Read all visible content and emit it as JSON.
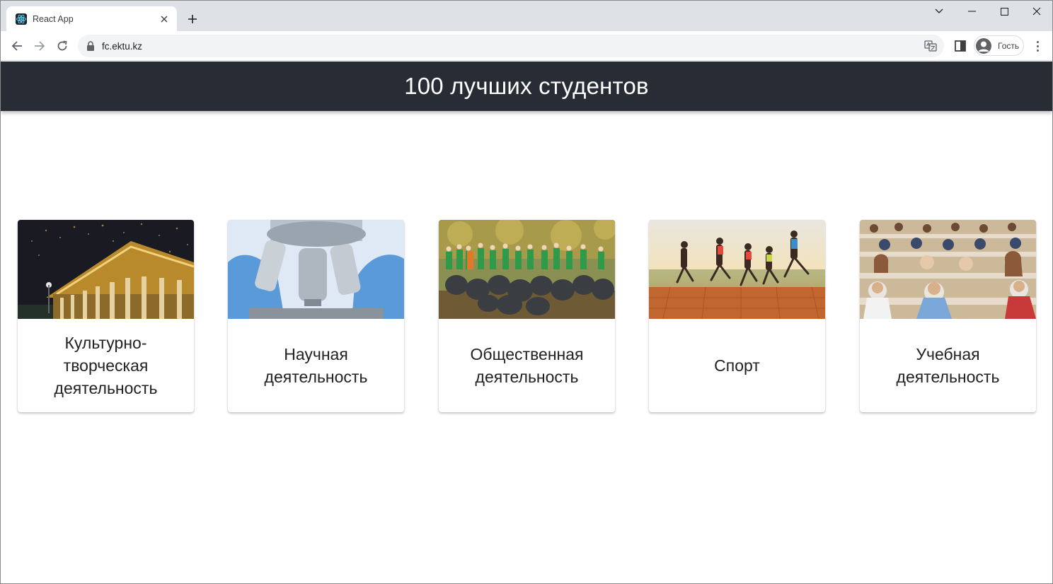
{
  "browser": {
    "tab_title": "React App",
    "url": "fc.ektu.kz",
    "profile_label": "Гость"
  },
  "header": {
    "title": "100 лучших студентов"
  },
  "cards": [
    {
      "label": "Культурно-творческая деятельность",
      "image": "university-building-fireworks"
    },
    {
      "label": "Научная деятельность",
      "image": "microscope-gloves"
    },
    {
      "label": "Общественная деятельность",
      "image": "volunteers-trash-bags"
    },
    {
      "label": "Спорт",
      "image": "runners-sunset"
    },
    {
      "label": "Учебная деятельность",
      "image": "students-lecture-hall"
    }
  ],
  "colors": {
    "header_bg": "#282c34",
    "header_text": "#ffffff",
    "tabstrip_bg": "#dee1e6"
  }
}
